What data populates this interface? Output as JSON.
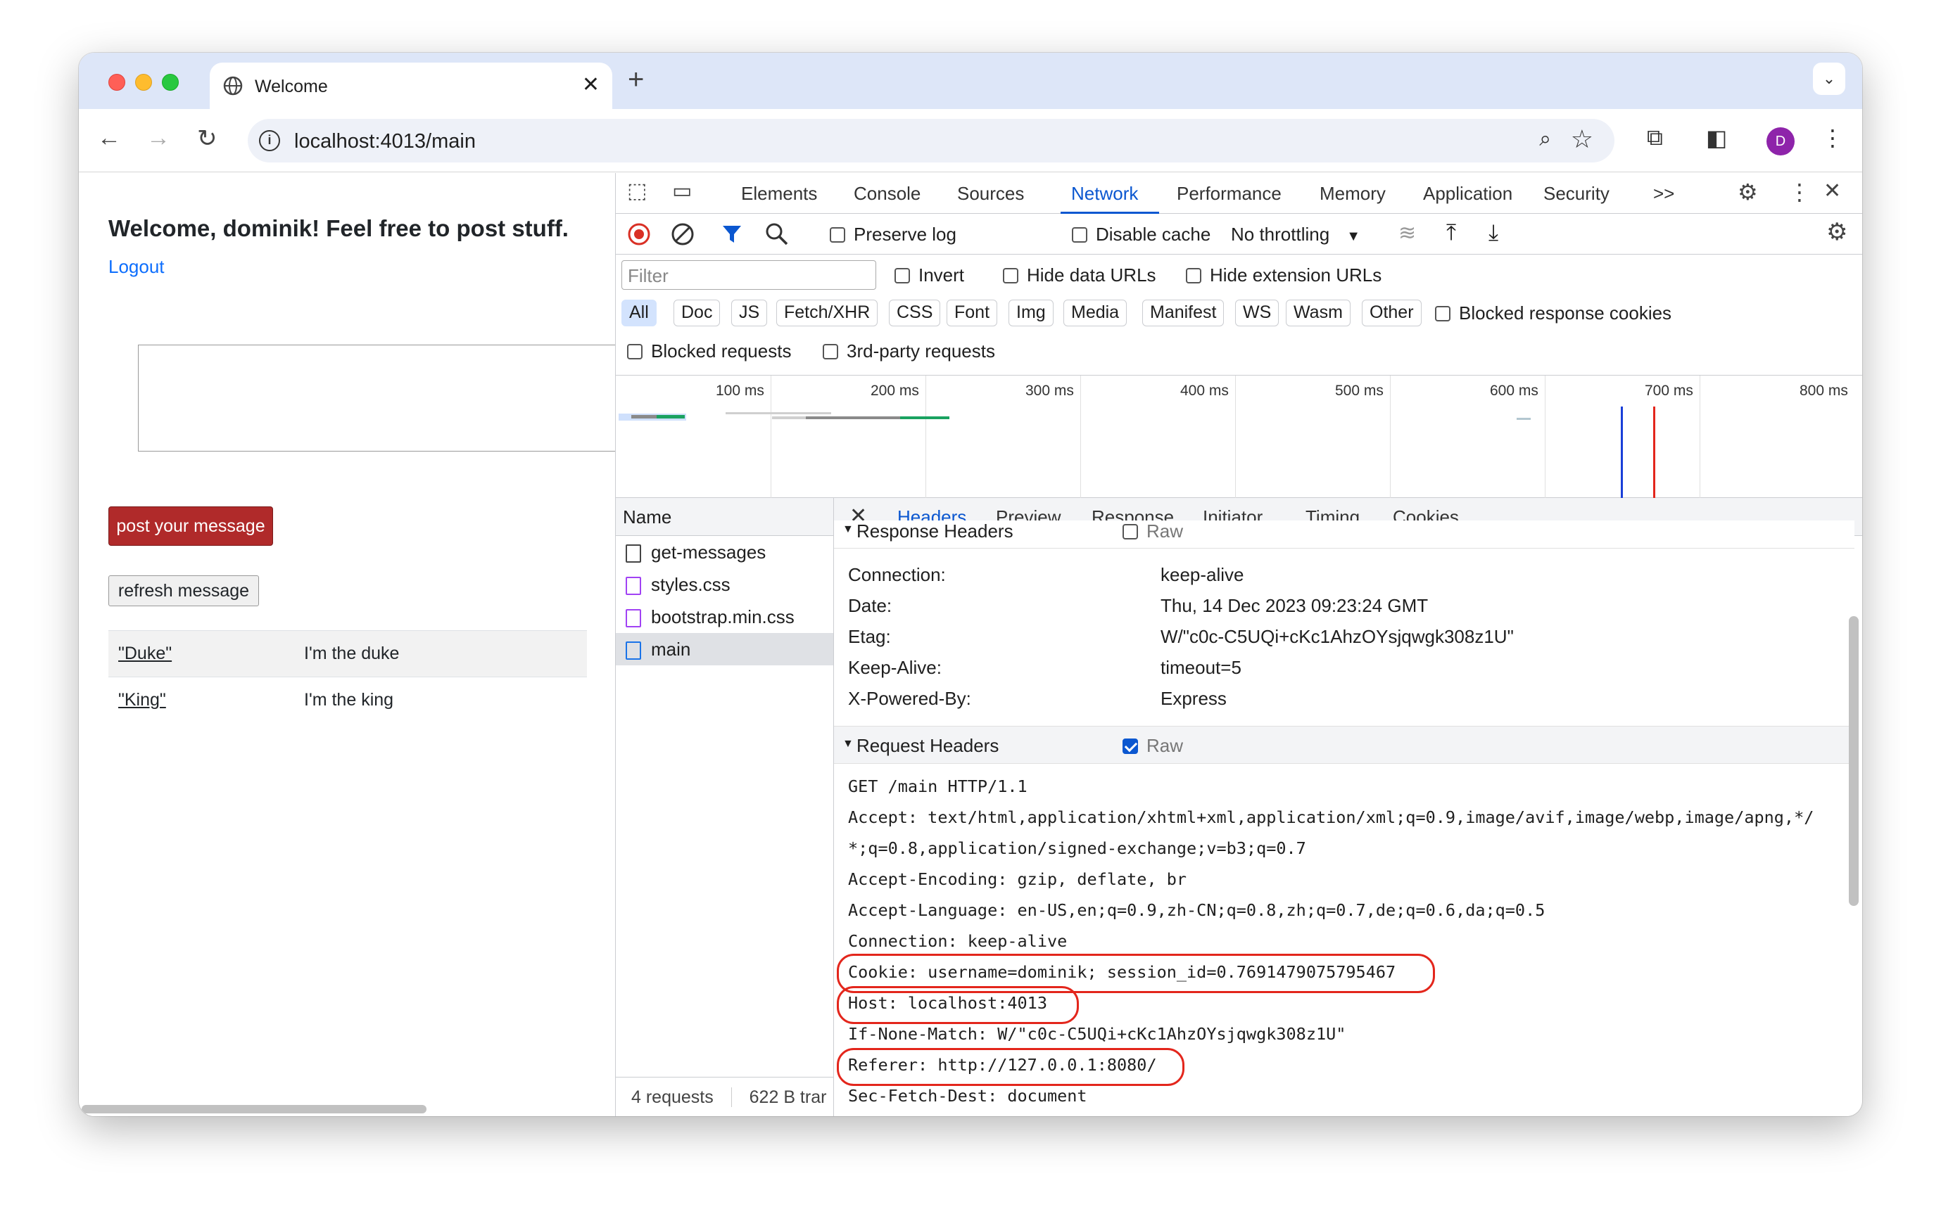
{
  "browser": {
    "tab_title": "Welcome",
    "tab_close": "✕",
    "new_tab": "+",
    "tab_menu": "⌄",
    "url": "localhost:4013/main",
    "avatar_letter": "D",
    "icons": [
      "back-arrow-icon",
      "forward-arrow-icon",
      "reload-icon",
      "site-info-icon",
      "zoom-icon",
      "bookmark-star-icon",
      "extensions-icon",
      "side-panel-icon",
      "menu-kebab-icon"
    ]
  },
  "page": {
    "heading": "Welcome, dominik! Feel free to post stuff.",
    "logout": "Logout",
    "post_button": "post your message",
    "refresh_button": "refresh message",
    "messages": [
      {
        "name": "\"Duke\"",
        "text": "I'm the duke"
      },
      {
        "name": "\"King\"",
        "text": "I'm the king"
      }
    ]
  },
  "devtools": {
    "tabs": [
      "Elements",
      "Console",
      "Sources",
      "Network",
      "Performance",
      "Memory",
      "Application",
      "Security"
    ],
    "more_tabs": ">>",
    "active_tab": "Network",
    "toolbar": {
      "preserve_log": "Preserve log",
      "disable_cache": "Disable cache",
      "throttling": "No throttling"
    },
    "filter": {
      "placeholder": "Filter",
      "invert": "Invert",
      "hide_data_urls": "Hide data URLs",
      "hide_extension_urls": "Hide extension URLs",
      "types": [
        "All",
        "Doc",
        "JS",
        "Fetch/XHR",
        "CSS",
        "Font",
        "Img",
        "Media",
        "Manifest",
        "WS",
        "Wasm",
        "Other"
      ],
      "blocked_response_cookies": "Blocked response cookies",
      "blocked_requests": "Blocked requests",
      "third_party": "3rd-party requests"
    },
    "timeline": {
      "ticks": [
        "100 ms",
        "200 ms",
        "300 ms",
        "400 ms",
        "500 ms",
        "600 ms",
        "700 ms",
        "800 ms"
      ]
    },
    "requests": {
      "header": "Name",
      "items": [
        {
          "name": "get-messages",
          "kind": "fetch"
        },
        {
          "name": "styles.css",
          "kind": "css"
        },
        {
          "name": "bootstrap.min.css",
          "kind": "css"
        },
        {
          "name": "main",
          "kind": "doc"
        }
      ],
      "footer_count": "4 requests",
      "footer_size": "622 B trar"
    },
    "details": {
      "close": "✕",
      "tabs": [
        "Headers",
        "Preview",
        "Response",
        "Initiator",
        "Timing",
        "Cookies"
      ],
      "active_tab": "Headers",
      "response_section": "Response Headers",
      "raw_label": "Raw",
      "response_headers": [
        {
          "k": "Connection:",
          "v": "keep-alive"
        },
        {
          "k": "Date:",
          "v": "Thu, 14 Dec 2023 09:23:24 GMT"
        },
        {
          "k": "Etag:",
          "v": "W/\"c0c-C5UQi+cKc1AhzOYsjqwgk308z1U\""
        },
        {
          "k": "Keep-Alive:",
          "v": "timeout=5"
        },
        {
          "k": "X-Powered-By:",
          "v": "Express"
        }
      ],
      "request_section": "Request Headers",
      "request_raw": [
        "GET /main HTTP/1.1",
        "Accept: text/html,application/xhtml+xml,application/xml;q=0.9,image/avif,image/webp,image/apng,*/",
        "*;q=0.8,application/signed-exchange;v=b3;q=0.7",
        "Accept-Encoding: gzip, deflate, br",
        "Accept-Language: en-US,en;q=0.9,zh-CN;q=0.8,zh;q=0.7,de;q=0.6,da;q=0.5",
        "Connection: keep-alive",
        "Cookie: username=dominik; session_id=0.7691479075795467",
        "Host: localhost:4013",
        "If-None-Match: W/\"c0c-C5UQi+cKc1AhzOYsjqwgk308z1U\"",
        "Referer: http://127.0.0.1:8080/",
        "Sec-Fetch-Dest: document"
      ]
    }
  }
}
